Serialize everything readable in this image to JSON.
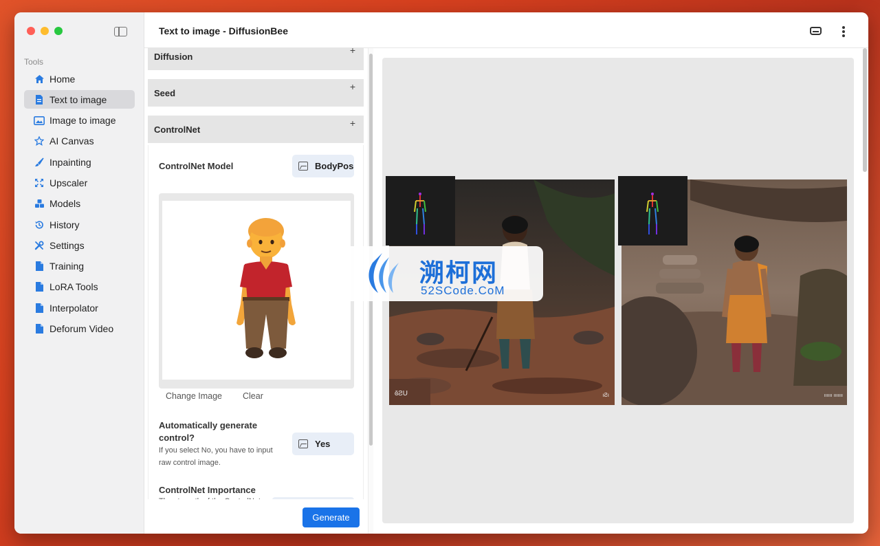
{
  "window": {
    "title": "Text to image - DiffusionBee"
  },
  "sidebar": {
    "section_label": "Tools",
    "items": [
      {
        "label": "Home",
        "icon": "home-icon",
        "active": false
      },
      {
        "label": "Text to image",
        "icon": "document-icon",
        "active": true
      },
      {
        "label": "Image to image",
        "icon": "image-icon",
        "active": false
      },
      {
        "label": "AI Canvas",
        "icon": "star-icon",
        "active": false
      },
      {
        "label": "Inpainting",
        "icon": "brush-icon",
        "active": false
      },
      {
        "label": "Upscaler",
        "icon": "expand-icon",
        "active": false
      },
      {
        "label": "Models",
        "icon": "cubes-icon",
        "active": false
      },
      {
        "label": "History",
        "icon": "history-icon",
        "active": false
      },
      {
        "label": "Settings",
        "icon": "tools-icon",
        "active": false
      },
      {
        "label": "Training",
        "icon": "file-icon",
        "active": false
      },
      {
        "label": "LoRA Tools",
        "icon": "file-icon",
        "active": false
      },
      {
        "label": "Interpolator",
        "icon": "file-icon",
        "active": false
      },
      {
        "label": "Deforum Video",
        "icon": "file-icon",
        "active": false
      }
    ]
  },
  "panel": {
    "accordions": [
      {
        "label": "Diffusion",
        "toggle": "+"
      },
      {
        "label": "Seed",
        "toggle": "+"
      },
      {
        "label": "ControlNet",
        "toggle": "+"
      }
    ],
    "controlnet": {
      "model_label": "ControlNet Model",
      "model_value": "BodyPose",
      "change_image": "Change Image",
      "clear": "Clear",
      "auto_label_1": "Automatically generate",
      "auto_label_2": "control?",
      "auto_value": "Yes",
      "auto_help": "If you select No, you have to input raw control image.",
      "importance_label": "ControlNet Importance",
      "importance_help": "The strength of the ControlNet"
    },
    "generate": "Generate"
  },
  "watermark": {
    "title": "溯柯网",
    "subtitle": "52SCode.CoM"
  },
  "results": {
    "image1_tag_left": "ɞ̆ƧU",
    "image1_tag_right": "ıƧı",
    "image2_tag_right": "ıııııı ııııııı"
  },
  "colors": {
    "accent": "#1a73e8",
    "active_nav": "#d9d9dc",
    "chip_bg": "#e8eef7"
  }
}
